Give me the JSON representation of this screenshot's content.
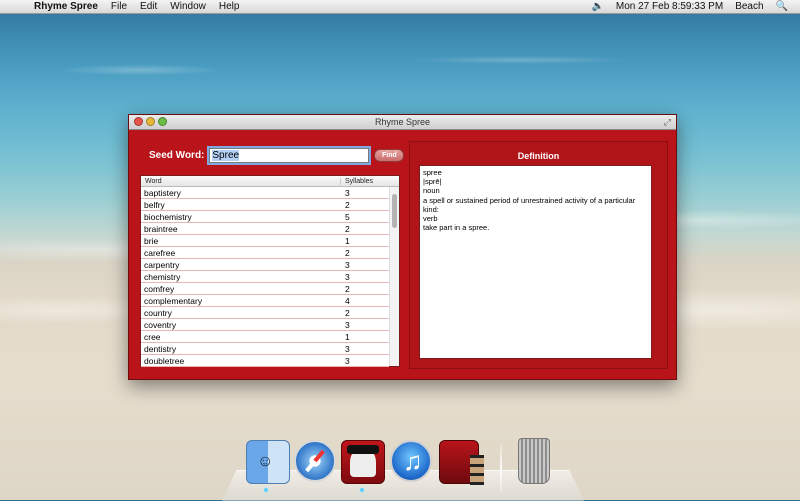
{
  "menubar": {
    "app_name": "Rhyme Spree",
    "menus": [
      "File",
      "Edit",
      "Window",
      "Help"
    ],
    "datetime": "Mon 27 Feb  8:59:33 PM",
    "user": "Beach"
  },
  "window": {
    "title": "Rhyme Spree",
    "seed_label": "Seed Word:",
    "seed_value": "Spree",
    "find_label": "Find",
    "table": {
      "headers": [
        "Word",
        "Syllables"
      ],
      "rows": [
        {
          "word": "baptistery",
          "syllables": "3"
        },
        {
          "word": "belfry",
          "syllables": "2"
        },
        {
          "word": "biochemistry",
          "syllables": "5"
        },
        {
          "word": "braintree",
          "syllables": "2"
        },
        {
          "word": "brie",
          "syllables": "1"
        },
        {
          "word": "carefree",
          "syllables": "2"
        },
        {
          "word": "carpentry",
          "syllables": "3"
        },
        {
          "word": "chemistry",
          "syllables": "3"
        },
        {
          "word": "comfrey",
          "syllables": "2"
        },
        {
          "word": "complementary",
          "syllables": "4"
        },
        {
          "word": "country",
          "syllables": "2"
        },
        {
          "word": "coventry",
          "syllables": "3"
        },
        {
          "word": "cree",
          "syllables": "1"
        },
        {
          "word": "dentistry",
          "syllables": "3"
        },
        {
          "word": "doubletree",
          "syllables": "3"
        }
      ]
    },
    "definition": {
      "title": "Definition",
      "lines": [
        "spree",
        "|sprē|",
        "noun",
        "a spell or sustained period of unrestrained activity of a particular kind:",
        "verb",
        "take part in a spree."
      ]
    }
  },
  "dock": {
    "icons": [
      "finder-icon",
      "safari-icon",
      "rhyme-spree-icon",
      "itunes-icon",
      "photo-booth-icon",
      "trash-icon"
    ]
  }
}
